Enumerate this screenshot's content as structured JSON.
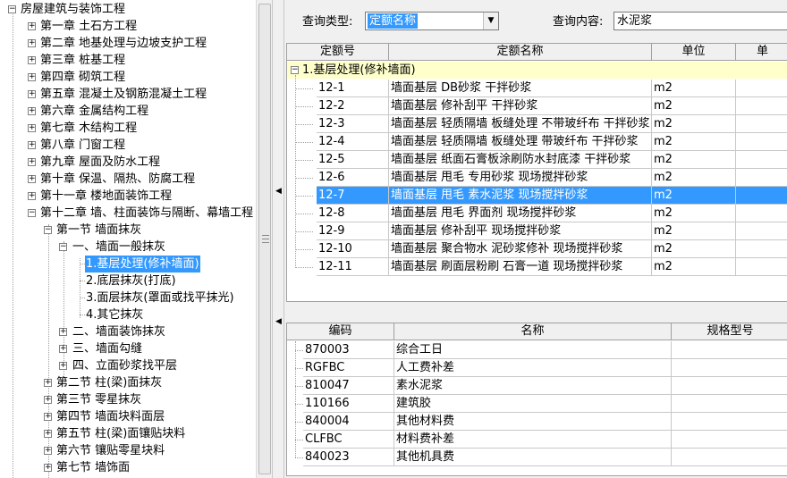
{
  "tree": {
    "root": "房屋建筑与装饰工程",
    "chapters": [
      "第一章 土石方工程",
      "第二章 地基处理与边坡支护工程",
      "第三章 桩基工程",
      "第四章 砌筑工程",
      "第五章 混凝土及钢筋混凝土工程",
      "第六章 金属结构工程",
      "第七章 木结构工程",
      "第八章 门窗工程",
      "第九章 屋面及防水工程",
      "第十章 保温、隔热、防腐工程",
      "第十一章 楼地面装饰工程",
      "第十二章 墙、柱面装饰与隔断、幕墙工程"
    ],
    "section1": "第一节 墙面抹灰",
    "subsection1": "一、墙面一般抹灰",
    "leaves": [
      "1.基层处理(修补墙面)",
      "2.底层抹灰(打底)",
      "3.面层抹灰(罩面或找平抹光)",
      "4.其它抹灰"
    ],
    "subsections_rest": [
      "二、墙面装饰抹灰",
      "三、墙面勾缝",
      "四、立面砂浆找平层"
    ],
    "sections_rest": [
      "第二节 柱(梁)面抹灰",
      "第三节 零星抹灰",
      "第四节 墙面块料面层",
      "第五节 柱(梁)面镶贴块料",
      "第六节 镶贴零星块料",
      "第七节 墙饰面"
    ]
  },
  "query": {
    "type_label": "查询类型:",
    "type_value": "定额名称",
    "content_label": "查询内容:",
    "content_value": "水泥浆"
  },
  "quota_table": {
    "headers": [
      "定额号",
      "定额名称",
      "单位",
      "单"
    ],
    "group": "1.基层处理(修补墙面)",
    "rows": [
      {
        "code": "12-1",
        "name": "墙面基层 DB砂浆 干拌砂浆",
        "unit": "m2"
      },
      {
        "code": "12-2",
        "name": "墙面基层 修补刮平 干拌砂浆",
        "unit": "m2"
      },
      {
        "code": "12-3",
        "name": "墙面基层 轻质隔墙 板缝处理 不带玻纤布 干拌砂浆",
        "unit": "m2"
      },
      {
        "code": "12-4",
        "name": "墙面基层 轻质隔墙 板缝处理 带玻纤布 干拌砂浆",
        "unit": "m2"
      },
      {
        "code": "12-5",
        "name": "墙面基层 纸面石膏板涂刷防水封底漆 干拌砂浆",
        "unit": "m2"
      },
      {
        "code": "12-6",
        "name": "墙面基层 甩毛 专用砂浆 现场搅拌砂浆",
        "unit": "m2"
      },
      {
        "code": "12-7",
        "name": "墙面基层 甩毛 素水泥浆 现场搅拌砂浆",
        "unit": "m2"
      },
      {
        "code": "12-8",
        "name": "墙面基层 甩毛 界面剂 现场搅拌砂浆",
        "unit": "m2"
      },
      {
        "code": "12-9",
        "name": "墙面基层 修补刮平 现场搅拌砂浆",
        "unit": "m2"
      },
      {
        "code": "12-10",
        "name": "墙面基层 聚合物水 泥砂浆修补 现场搅拌砂浆",
        "unit": "m2"
      },
      {
        "code": "12-11",
        "name": "墙面基层 刷面层粉刷 石膏一道 现场搅拌砂浆",
        "unit": "m2"
      }
    ]
  },
  "resource_table": {
    "headers": [
      "编码",
      "名称",
      "规格型号"
    ],
    "rows": [
      {
        "code": "870003",
        "name": "综合工日"
      },
      {
        "code": "RGFBC",
        "name": "人工费补差"
      },
      {
        "code": "810047",
        "name": "素水泥浆"
      },
      {
        "code": "110166",
        "name": "建筑胶"
      },
      {
        "code": "840004",
        "name": "其他材料费"
      },
      {
        "code": "CLFBC",
        "name": "材料费补差"
      },
      {
        "code": "840023",
        "name": "其他机具费"
      }
    ]
  }
}
